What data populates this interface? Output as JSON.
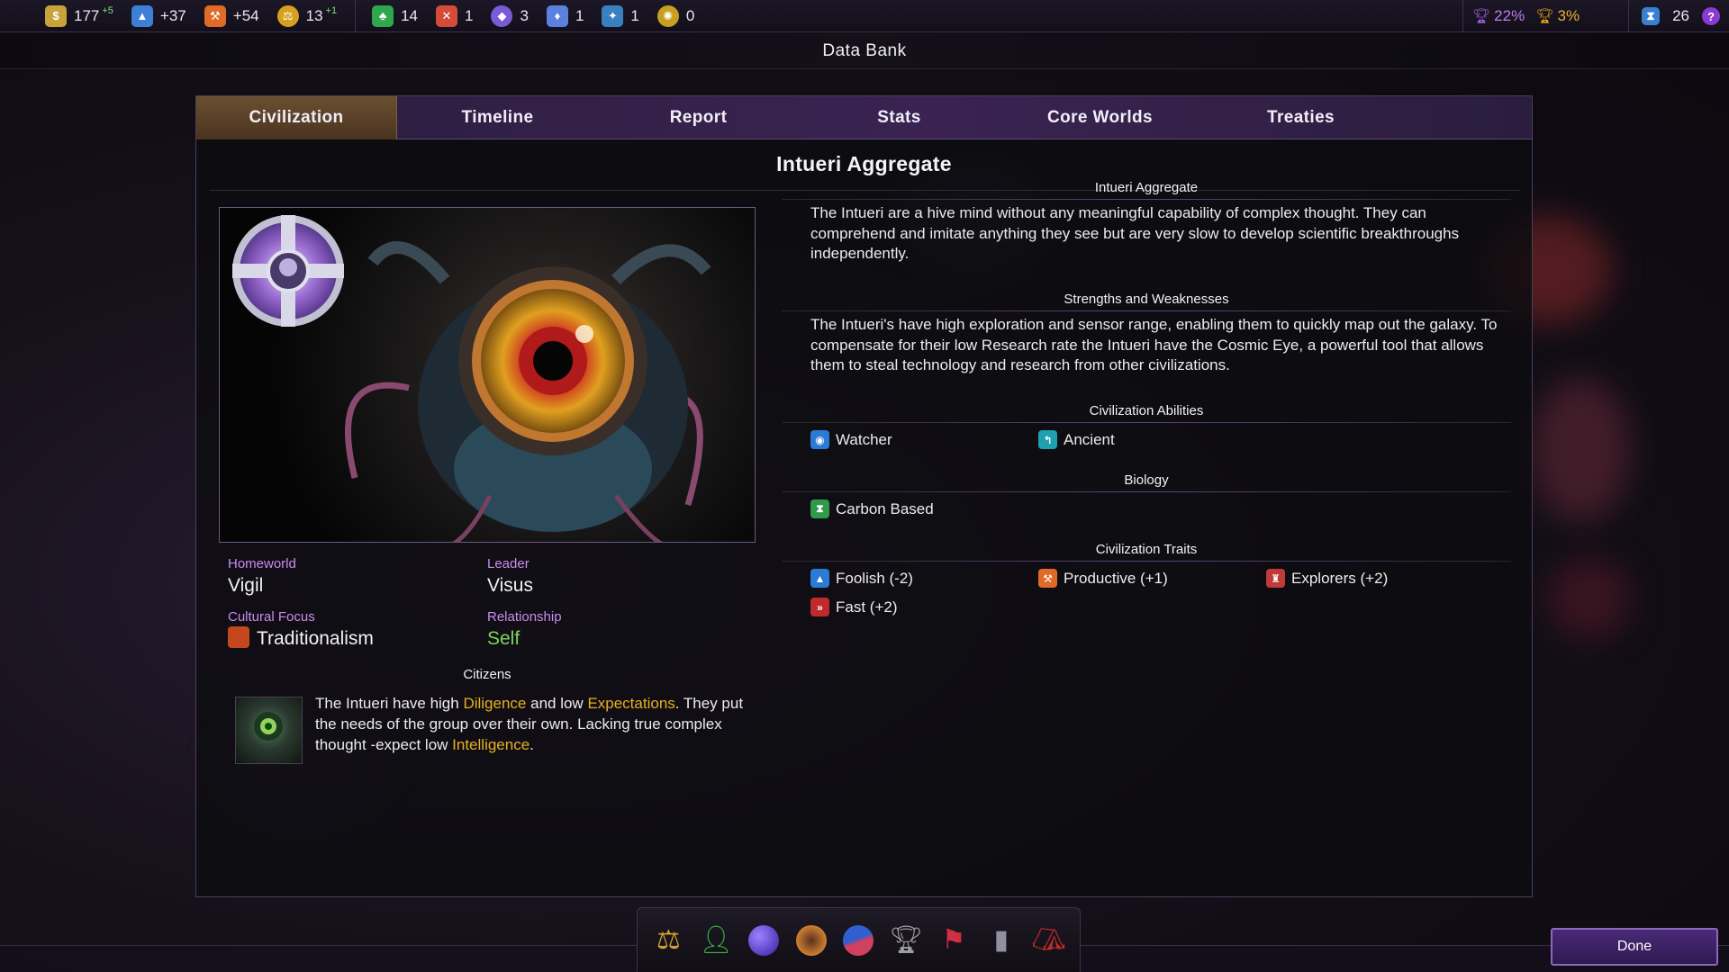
{
  "topbar": {
    "left": [
      {
        "icon": "credits-icon",
        "value": "177",
        "delta": "+5",
        "color": "#c9a23a"
      },
      {
        "icon": "research-icon",
        "value": "+37",
        "delta": "",
        "color": "#3d7fd6"
      },
      {
        "icon": "manufacturing-icon",
        "value": "+54",
        "delta": "",
        "color": "#e06a28"
      },
      {
        "icon": "influence-icon",
        "value": "13",
        "delta": "+1",
        "color": "#d6a020"
      }
    ],
    "strategic": [
      {
        "icon": "food-icon",
        "value": "14",
        "color": "#2ea84a"
      },
      {
        "icon": "war-icon",
        "value": "1",
        "color": "#d64a3a"
      },
      {
        "icon": "crystal-icon",
        "value": "3",
        "color": "#7a5ad6"
      },
      {
        "icon": "elerium-icon",
        "value": "1",
        "color": "#5a80e0"
      },
      {
        "icon": "antimatter-icon",
        "value": "1",
        "color": "#3a80c0"
      },
      {
        "icon": "durantium-icon",
        "value": "0",
        "color": "#c8a020"
      }
    ],
    "right": [
      {
        "icon": "score-trophy-icon",
        "value": "22%",
        "color": "#a060e0"
      },
      {
        "icon": "victory-trophy-icon",
        "value": "3%",
        "color": "#e0a020"
      },
      {
        "icon": "turn-hourglass-icon",
        "value": "26",
        "color": "#3a80d0"
      }
    ],
    "help_label": "?"
  },
  "window_title": "Data Bank",
  "tabs": [
    {
      "label": "Civilization",
      "active": true
    },
    {
      "label": "Timeline",
      "active": false
    },
    {
      "label": "Report",
      "active": false
    },
    {
      "label": "Stats",
      "active": false
    },
    {
      "label": "Core Worlds",
      "active": false
    },
    {
      "label": "Treaties",
      "active": false
    }
  ],
  "civ": {
    "name": "Intueri Aggregate",
    "homeworld_label": "Homeworld",
    "homeworld": "Vigil",
    "leader_label": "Leader",
    "leader": "Visus",
    "cultural_focus_label": "Cultural Focus",
    "cultural_focus": "Traditionalism",
    "relationship_label": "Relationship",
    "relationship": "Self",
    "citizens_title": "Citizens",
    "citizens_text": {
      "t1": "The Intueri have high ",
      "h1": "Diligence",
      "t2": " and low ",
      "h2": "Expectations",
      "t3": ". They put the needs of the group over their own. Lacking true complex thought -expect low ",
      "h3": "Intelligence",
      "t4": "."
    }
  },
  "details": {
    "desc_title": "Intueri Aggregate",
    "desc_text": "The Intueri are a hive mind without any meaningful capability of complex thought. They can comprehend and imitate anything they see but are very slow to develop scientific breakthroughs independently.",
    "sw_title": "Strengths and Weaknesses",
    "sw_text": "The Intueri's have high exploration and sensor range, enabling them to quickly map out the galaxy. To compensate for their low Research rate the Intueri have the Cosmic Eye, a powerful tool that allows them to steal technology and research from other civilizations.",
    "abilities_title": "Civilization Abilities",
    "abilities": [
      {
        "label": "Watcher",
        "icon": "eye-icon",
        "color": "#2a7ad6"
      },
      {
        "label": "Ancient",
        "icon": "ancient-icon",
        "color": "#1ea0b0"
      }
    ],
    "biology_title": "Biology",
    "biology": {
      "label": "Carbon Based",
      "icon": "carbon-icon",
      "color": "#2e9a4a"
    },
    "traits_title": "Civilization Traits",
    "traits": [
      {
        "label": "Foolish (-2)",
        "icon": "flask-icon",
        "color": "#2a7ad6"
      },
      {
        "label": "Productive (+1)",
        "icon": "hammer-icon",
        "color": "#e06a28"
      },
      {
        "label": "Explorers (+2)",
        "icon": "explorer-icon",
        "color": "#c03a3a"
      },
      {
        "label": "Fast (+2)",
        "icon": "fast-forward-icon",
        "color": "#c02a2a"
      }
    ]
  },
  "dock": [
    {
      "name": "scales-icon",
      "glyph": "⚖",
      "color": "#d6a030"
    },
    {
      "name": "citizen-icon",
      "glyph": "●",
      "color": "#3ab040"
    },
    {
      "name": "planet-icon",
      "glyph": "●",
      "color": "#6a50d0"
    },
    {
      "name": "crest-icon",
      "glyph": "◉",
      "color": "#d08030"
    },
    {
      "name": "chart-icon",
      "glyph": "◔",
      "color": "#d04060"
    },
    {
      "name": "trophy-icon",
      "glyph": "♜",
      "color": "#a0a0a0"
    },
    {
      "name": "flag-icon",
      "glyph": "⚑",
      "color": "#d03040"
    },
    {
      "name": "pillar-icon",
      "glyph": "▮",
      "color": "#9090a0"
    },
    {
      "name": "tent-icon",
      "glyph": "▲",
      "color": "#c02a2a"
    }
  ],
  "done_label": "Done"
}
